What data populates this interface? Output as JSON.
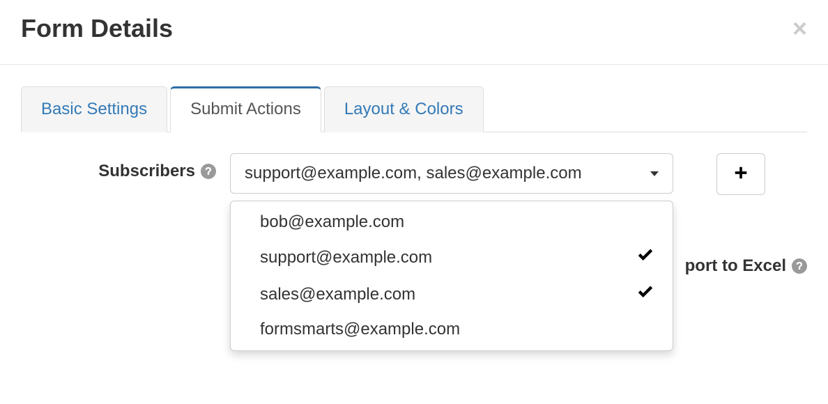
{
  "modal": {
    "title": "Form Details"
  },
  "tabs": [
    {
      "label": "Basic Settings",
      "active": false
    },
    {
      "label": "Submit Actions",
      "active": true
    },
    {
      "label": "Layout & Colors",
      "active": false
    }
  ],
  "subscribers": {
    "label": "Subscribers",
    "selected_display": "support@example.com, sales@example.com",
    "options": [
      {
        "label": "bob@example.com",
        "selected": false
      },
      {
        "label": "support@example.com",
        "selected": true
      },
      {
        "label": "sales@example.com",
        "selected": true
      },
      {
        "label": "formsmarts@example.com",
        "selected": false
      }
    ]
  },
  "partial_right_label": "port to Excel",
  "icons": {
    "help": "question-circle-icon",
    "close": "close-icon",
    "add": "plus-icon",
    "check": "check-icon",
    "caret": "caret-down-icon"
  }
}
